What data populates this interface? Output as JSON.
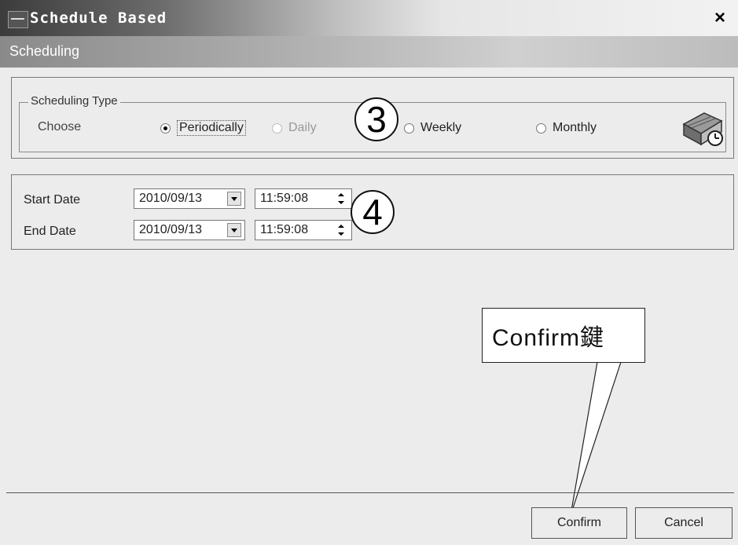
{
  "window": {
    "title": "Schedule Based",
    "close_label": "×",
    "subheader": "Scheduling"
  },
  "scheduling_type": {
    "legend": "Scheduling Type",
    "choose_label": "Choose",
    "options": [
      {
        "label": "Periodically",
        "selected": true,
        "disabled": false
      },
      {
        "label": "Daily",
        "selected": false,
        "disabled": true
      },
      {
        "label": "Weekly",
        "selected": false,
        "disabled": false
      },
      {
        "label": "Monthly",
        "selected": false,
        "disabled": false
      }
    ],
    "icon": "scheduler-clock-icon"
  },
  "dates": {
    "start_label": "Start Date",
    "start_date": "2010/09/13",
    "start_time": "11:59:08",
    "end_label": "End Date",
    "end_date": "2010/09/13",
    "end_time": "11:59:08"
  },
  "callouts": {
    "three": "3",
    "four": "4",
    "confirm_note": "Confirm鍵"
  },
  "buttons": {
    "confirm": "Confirm",
    "cancel": "Cancel"
  }
}
